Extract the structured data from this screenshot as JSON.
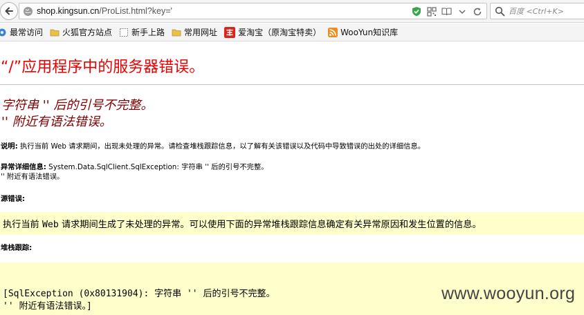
{
  "browser": {
    "url_host": "shop.kingsun.cn",
    "url_path": "/ProList.html?key='",
    "search_placeholder": "百度 <Ctrl+K>"
  },
  "bookmarks": [
    {
      "label": "最常访问",
      "icon": "gear-icon"
    },
    {
      "label": "火狐官方站点",
      "icon": "folder-icon"
    },
    {
      "label": "新手上路",
      "icon": "blank-page-icon"
    },
    {
      "label": "常用网址",
      "icon": "folder-icon"
    },
    {
      "label": "爱淘宝（原淘宝特卖）",
      "icon": "taobao-icon"
    },
    {
      "label": "WooYun知识库",
      "icon": "rss-icon"
    }
  ],
  "page": {
    "title": "“/”应用程序中的服务器错误。",
    "error_line1": "字符串 '' 后的引号不完整。",
    "error_line2": "'' 附近有语法错误。",
    "description_label": "说明:",
    "description_text": " 执行当前 Web 请求期间，出现未处理的异常。请检查堆栈跟踪信息，以了解有关该错误以及代码中导致错误的出处的详细信息。",
    "exception_label": "异常详细信息:",
    "exception_text": " System.Data.SqlClient.SqlException: 字符串 '' 后的引号不完整。",
    "exception_text2": "'' 附近有语法错误。",
    "source_label": "源错误:",
    "source_text_pre": "执行当前 ",
    "source_text_web": "Web",
    "source_text_post": " 请求期间生成了未处理的异常。可以使用下面的异常堆栈跟踪信息确定有关异常原因和发生位置的信息。",
    "stack_label": "堆栈跟踪:",
    "stack_line1": "[SqlException (0x80131904): 字符串 '' 后的引号不完整。",
    "stack_line2": "'' 附近有语法错误。]"
  },
  "watermark": "www.wooyun.org",
  "colors": {
    "title_red": "#ee0000",
    "error_maroon": "#800000",
    "code_bg": "#ffffcc"
  }
}
